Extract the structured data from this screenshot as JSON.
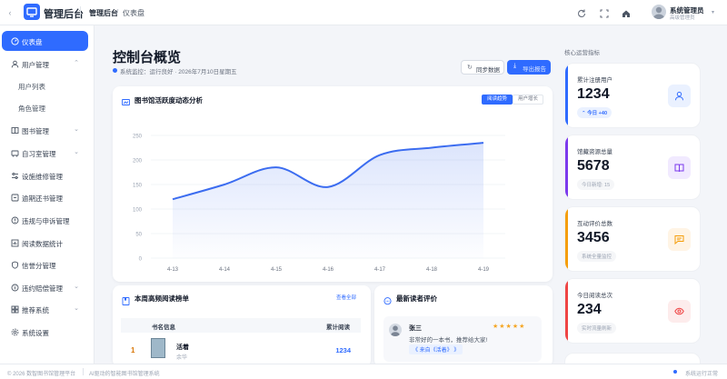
{
  "header": {
    "brand": "管理后台",
    "breadcrumb_home": "管理后台",
    "breadcrumb_sep": "/",
    "breadcrumb_current": "仪表盘",
    "user_name": "系统管理员",
    "user_role": "高级管理员"
  },
  "sidebar": {
    "items": [
      {
        "label": "仪表盘",
        "icon": "dashboard-icon",
        "active": true
      },
      {
        "label": "用户管理",
        "icon": "user-icon",
        "expanded": true
      },
      {
        "label": "用户列表",
        "sub": true
      },
      {
        "label": "角色管理",
        "sub": true
      },
      {
        "label": "图书管理",
        "icon": "book-icon",
        "chevron": true
      },
      {
        "label": "自习室管理",
        "icon": "room-icon",
        "chevron": true
      },
      {
        "label": "设施维修管理",
        "icon": "tools-icon"
      },
      {
        "label": "逾期还书管理",
        "icon": "overdue-icon"
      },
      {
        "label": "违规与申诉管理",
        "icon": "appeal-icon"
      },
      {
        "label": "阅读数据统计",
        "icon": "stats-icon"
      },
      {
        "label": "信誉分管理",
        "icon": "credit-icon"
      },
      {
        "label": "违约赔偿管理",
        "icon": "compensation-icon",
        "chevron": true
      },
      {
        "label": "推荐系统",
        "icon": "recommend-icon",
        "chevron": true
      },
      {
        "label": "系统设置",
        "icon": "settings-icon"
      }
    ]
  },
  "main": {
    "title": "控制台概览",
    "monitor": "系统监控：运行良好 · 2026年7月10日星期五",
    "sync_label": "同步数据",
    "export_label": "导出报告"
  },
  "chart_card": {
    "title": "图书馆活跃度动态分析",
    "toggle_on": "阅读趋势",
    "toggle_off": "用户增长"
  },
  "chart_data": {
    "type": "area",
    "title": "图书馆活跃度动态分析",
    "categories": [
      "4-13",
      "4-14",
      "4-15",
      "4-16",
      "4-17",
      "4-18",
      "4-19"
    ],
    "series": [
      {
        "values": [
          120,
          150,
          185,
          145,
          210,
          225,
          235
        ]
      }
    ],
    "ylim": [
      0,
      250
    ],
    "yticks": [
      0,
      50,
      100,
      150,
      200,
      250
    ],
    "grid": true,
    "color": "#3b6cf0"
  },
  "ranking": {
    "title": "本周高频阅读榜单",
    "link": "查看全部",
    "col_book": "书名信息",
    "col_count": "累计阅读",
    "rows": [
      {
        "rank": "1",
        "title": "活着",
        "author": "余华",
        "count": "1234"
      }
    ]
  },
  "reviews": {
    "title": "最新读者评价",
    "items": [
      {
        "name": "张三",
        "stars": "★★★★★",
        "text": "非常好的一本书，推荐给大家!",
        "from": "《 来自《活着》 》"
      }
    ]
  },
  "stats": {
    "heading": "核心运营指标",
    "cards": [
      {
        "label": "累计注册用户",
        "value": "1234",
        "sub": "今日 +40",
        "color": "#2f6bff",
        "bg": "#eaf1ff",
        "icon": "user-icon"
      },
      {
        "label": "馆藏资源总量",
        "value": "5678",
        "sub": "今日新增: 15",
        "color": "#7c3aed",
        "bg": "#f1eaff",
        "icon": "book-icon"
      },
      {
        "label": "互动评价总数",
        "value": "3456",
        "sub": "系统全量监控",
        "color": "#f59e0b",
        "bg": "#fff4e5",
        "icon": "comment-icon"
      },
      {
        "label": "今日阅读总次",
        "value": "234",
        "sub": "实时流量刷新",
        "color": "#ef4444",
        "bg": "#fdecec",
        "icon": "eye-icon"
      }
    ]
  },
  "footer": {
    "copyright": "© 2026 数智图书馆管理平台",
    "tagline": "AI驱动的智能图书馆管理系统",
    "status": "系统运行正常"
  }
}
